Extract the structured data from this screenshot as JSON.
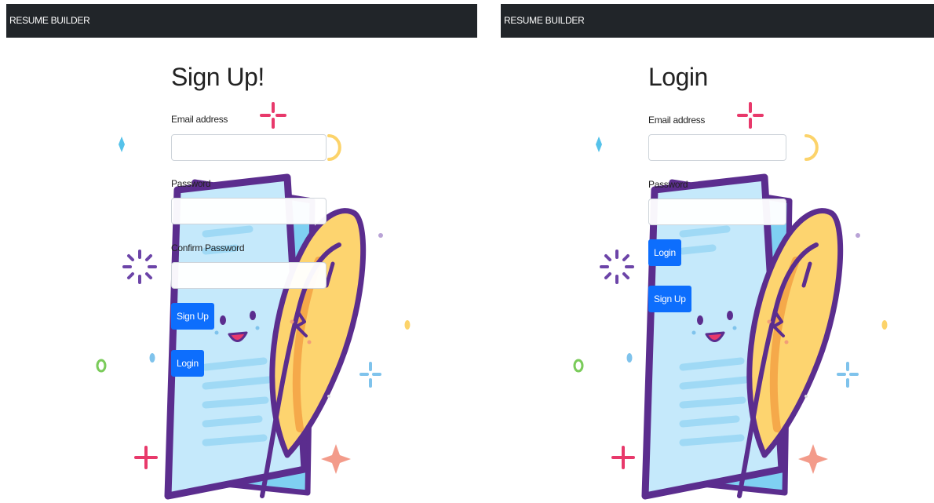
{
  "signup": {
    "navbar": {
      "brand": "RESUME BUILDER"
    },
    "title": "Sign Up!",
    "email_label": "Email address",
    "email_value": "",
    "password_label": "Password",
    "password_value": "",
    "confirm_label": "Confirm Password",
    "confirm_value": "",
    "primary_button": "Sign Up",
    "secondary_button": "Login"
  },
  "login": {
    "navbar": {
      "brand": "RESUME BUILDER"
    },
    "title": "Login",
    "email_label": "Email address",
    "email_value": "",
    "password_label": "Password",
    "password_value": "",
    "primary_button": "Login",
    "secondary_button": "Sign Up"
  },
  "colors": {
    "navbar": "#212529",
    "button": "#0d6efd",
    "illustration_outline": "#5b2d8e",
    "paper": "#bfe6fb",
    "quill": "#fcd36a"
  }
}
